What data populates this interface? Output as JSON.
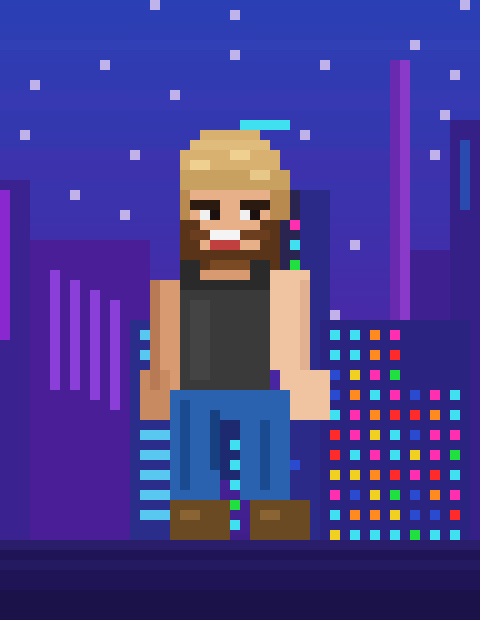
{
  "scene": {
    "subject": "pixel-art-bearded-man",
    "setting": "neon-city-night",
    "palette": {
      "sky_top": "#2a3fb0",
      "sky_mid": "#4a28a8",
      "sky_low": "#5a1f9a",
      "street": "#1e1456",
      "hair": "#d8b070",
      "beard": "#5a3418",
      "skin": "#e8b088",
      "tank_top": "#3a3a3a",
      "jeans": "#1f5aa8",
      "boots": "#6a4a22",
      "neon_cyan": "#40e0f0",
      "neon_magenta": "#ff2fb0",
      "neon_green": "#20e040",
      "neon_orange": "#ff8a20",
      "neon_yellow": "#f0d020"
    }
  }
}
